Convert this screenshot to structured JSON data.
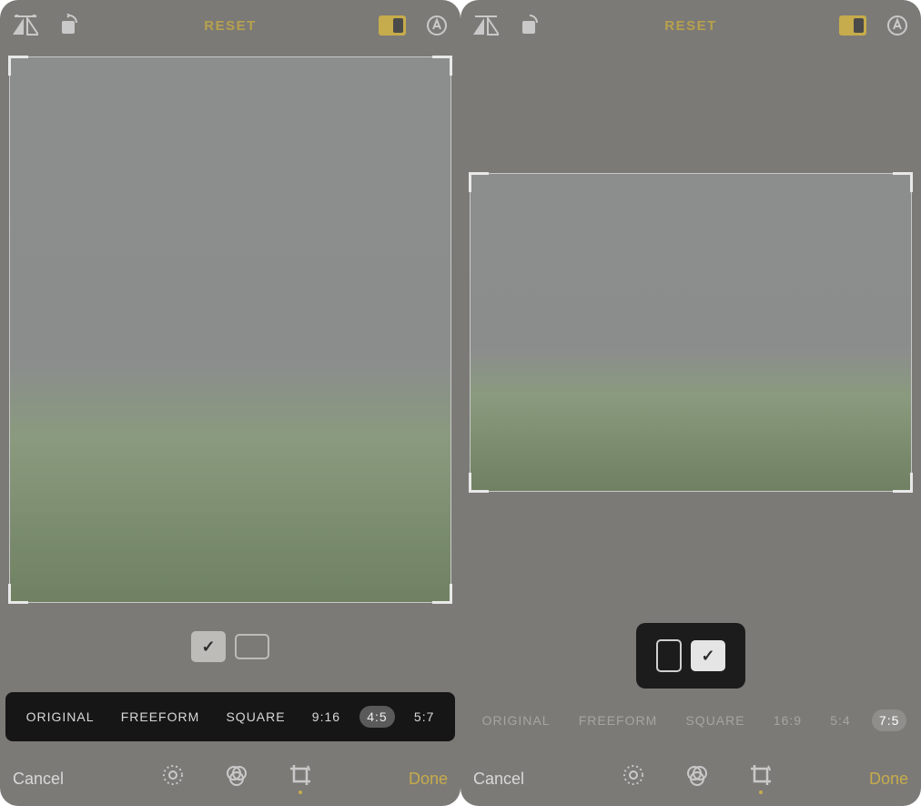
{
  "left": {
    "topbar": {
      "reset": "RESET"
    },
    "orientation": {
      "portrait_selected": true,
      "landscape_selected": false
    },
    "ratios": [
      {
        "label": "ORIGINAL",
        "selected": false
      },
      {
        "label": "FREEFORM",
        "selected": false
      },
      {
        "label": "SQUARE",
        "selected": false
      },
      {
        "label": "9:16",
        "selected": false
      },
      {
        "label": "4:5",
        "selected": true
      },
      {
        "label": "5:7",
        "selected": false
      }
    ],
    "bottombar": {
      "cancel": "Cancel",
      "done": "Done"
    }
  },
  "right": {
    "topbar": {
      "reset": "RESET"
    },
    "orientation": {
      "portrait_selected": false,
      "landscape_selected": true
    },
    "ratios": [
      {
        "label": "ORIGINAL",
        "selected": false
      },
      {
        "label": "FREEFORM",
        "selected": false
      },
      {
        "label": "SQUARE",
        "selected": false
      },
      {
        "label": "16:9",
        "selected": false
      },
      {
        "label": "5:4",
        "selected": false
      },
      {
        "label": "7:5",
        "selected": true
      }
    ],
    "bottombar": {
      "cancel": "Cancel",
      "done": "Done"
    }
  }
}
